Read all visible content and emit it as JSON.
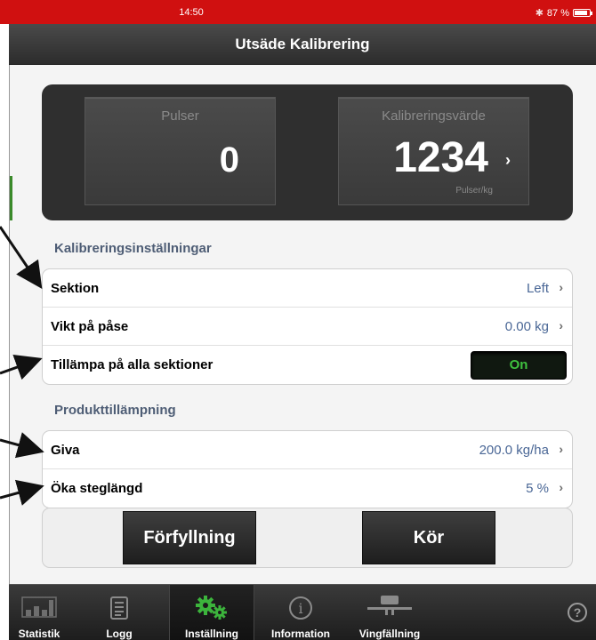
{
  "status_bar": {
    "time": "14:50",
    "battery": "87 %",
    "battery_level": 0.87
  },
  "nav": {
    "title": "Utsäde Kalibrering"
  },
  "pulse_panel": {
    "pulses_label": "Pulser",
    "pulses_value": "0",
    "calibration_label": "Kalibreringsvärde",
    "calibration_value": "1234",
    "calibration_unit": "Pulser/kg"
  },
  "calibration_settings": {
    "header": "Kalibreringsinställningar",
    "rows": [
      {
        "label": "Sektion",
        "value": "Left"
      },
      {
        "label": "Vikt på påse",
        "value": "0.00 kg"
      },
      {
        "label": "Tillämpa på alla sektioner",
        "toggle": "On"
      }
    ]
  },
  "product_application": {
    "header": "Produkttillämpning",
    "rows": [
      {
        "label": "Giva",
        "value": "200.0 kg/ha"
      },
      {
        "label": "Öka steglängd",
        "value": "5 %"
      }
    ]
  },
  "actions": {
    "prefill": "Förfyllning",
    "run": "Kör"
  },
  "tabs": [
    {
      "label": "Statistik",
      "icon": "bar-chart-icon"
    },
    {
      "label": "Logg",
      "icon": "notepad-icon"
    },
    {
      "label": "Inställning",
      "icon": "gears-icon",
      "active": true
    },
    {
      "label": "Information",
      "icon": "info-icon"
    },
    {
      "label": "Vingfällning",
      "icon": "wing-fold-icon"
    }
  ],
  "help": {
    "glyph": "?"
  },
  "colors": {
    "status_bar": "#d01010",
    "toggle_on_text": "#3fc23f",
    "value_text": "#4a6796",
    "section_header": "#4e5d75",
    "gear_green": "#3cb43c"
  }
}
